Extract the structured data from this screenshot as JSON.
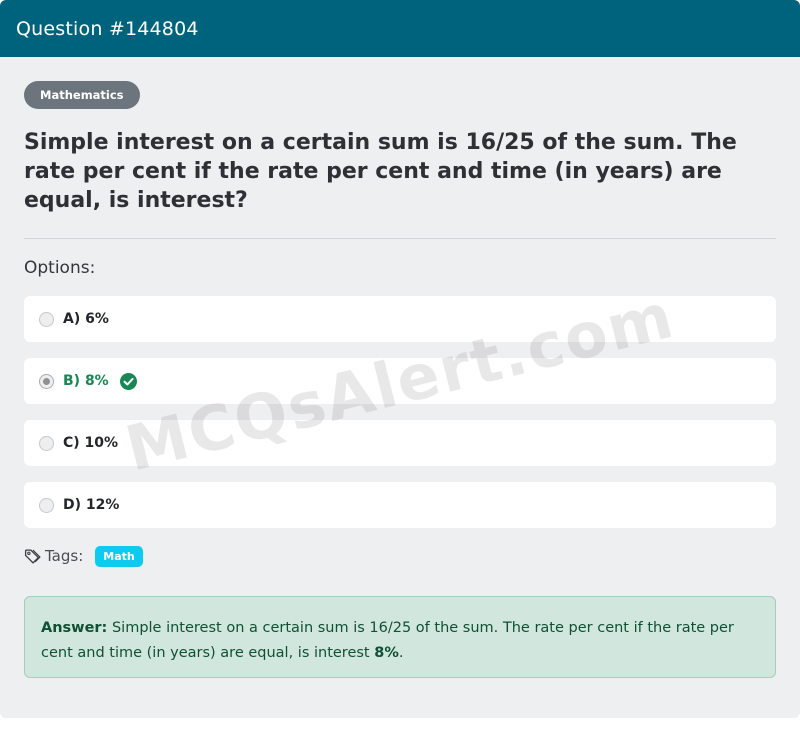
{
  "header": {
    "title": "Question #144804"
  },
  "category": "Mathematics",
  "question": "Simple interest on a certain sum is 16/25 of the sum. The rate per cent if the rate per cent and time (in years) are equal, is interest?",
  "options_label": "Options:",
  "options": [
    {
      "label": "A) 6%",
      "selected": false,
      "correct": false
    },
    {
      "label": "B) 8%",
      "selected": true,
      "correct": true
    },
    {
      "label": "C) 10%",
      "selected": false,
      "correct": false
    },
    {
      "label": "D) 12%",
      "selected": false,
      "correct": false
    }
  ],
  "tags": {
    "label": "Tags:",
    "items": [
      "Math"
    ]
  },
  "answer": {
    "prefix": "Answer:",
    "text": "Simple interest on a certain sum is 16/25 of the sum. The rate per cent if the rate per cent and time (in years) are equal, is interest",
    "value": "8%",
    "suffix": "."
  },
  "watermark": "MCQsAlert.com",
  "colors": {
    "header": "#00637d",
    "correct": "#198754",
    "tag": "#0dcaf0",
    "answer_bg": "#d1e7dd",
    "badge": "#6c757d"
  },
  "icons": {
    "correct": "check-circle-icon",
    "tags": "tag-icon"
  }
}
